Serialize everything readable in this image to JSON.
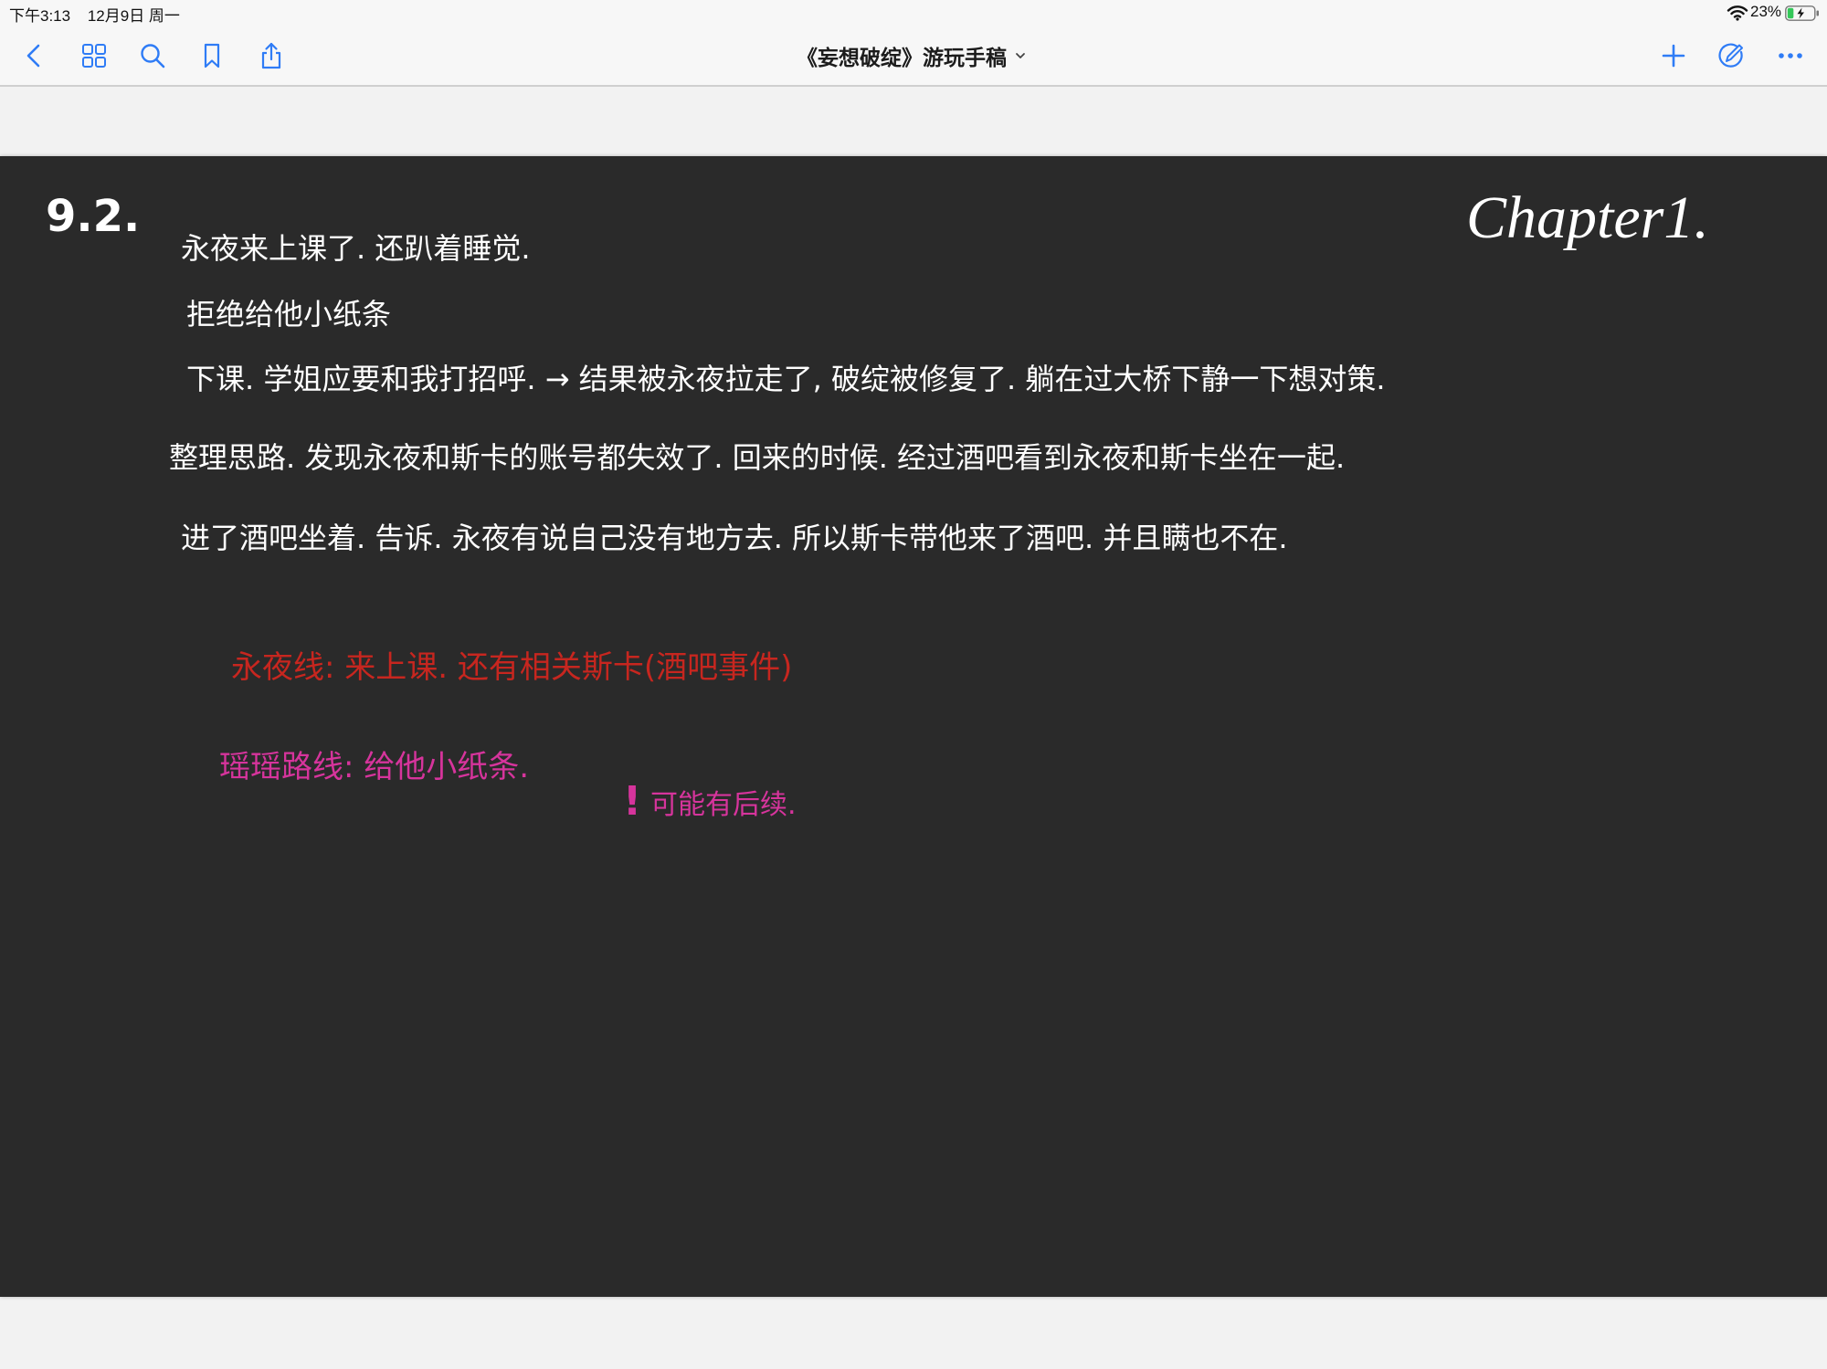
{
  "status_bar": {
    "time": "下午3:13",
    "date": "12月9日 周一",
    "battery": "23%",
    "battery_level": 0.23,
    "icons": [
      "wifi-icon",
      "battery-icon"
    ]
  },
  "toolbar": {
    "title": "《妄想破绽》游玩手稿",
    "left_icons": [
      "back-icon",
      "grid-icon",
      "search-icon",
      "bookmark-icon",
      "share-icon"
    ],
    "right_icons": [
      "add-icon",
      "pencil-circle-icon",
      "more-icon"
    ]
  },
  "note": {
    "date": "9.2.",
    "chapter": "Chapter1.",
    "lines": [
      "永夜来上课了. 还趴着睡觉.",
      "拒绝给他小纸条",
      "下课. 学姐应要和我打招呼. → 结果被永夜拉走了, 破绽被修复了. 躺在过大桥下静一下想对策.",
      "整理思路. 发现永夜和斯卡的账号都失效了. 回来的时候. 经过酒吧看到永夜和斯卡坐在一起.",
      "进了酒吧坐着. 告诉. 永夜有说自己没有地方去. 所以斯卡带他来了酒吧. 并且瞒也不在."
    ],
    "red_line": "永夜线: 来上课. 还有相关斯卡(酒吧事件)",
    "pink_line": "瑶瑶路线: 给他小纸条.",
    "exclaim": "!",
    "pink_note": "可能有后续."
  },
  "colors": {
    "accent": "#2f7cf6",
    "page": "#2a2a2a",
    "ink_white": "#ffffff",
    "ink_red": "#c7261f",
    "ink_pink": "#d6349c",
    "battery_fill": "#34c759"
  }
}
